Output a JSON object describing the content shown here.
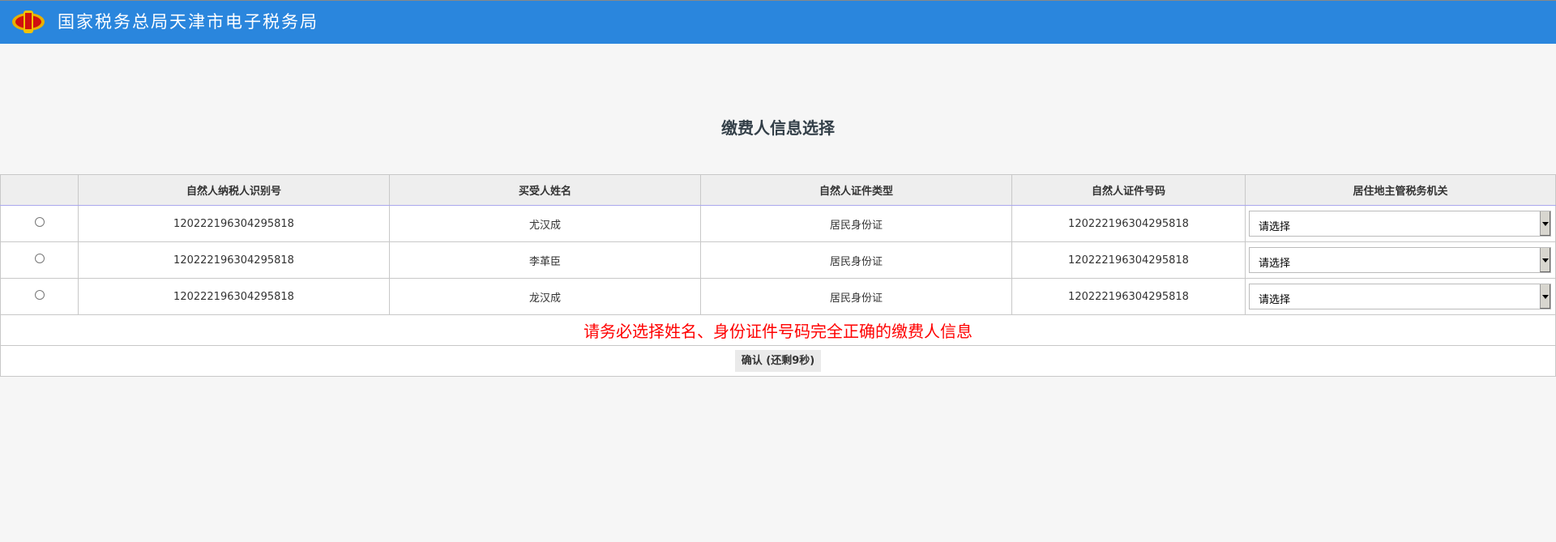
{
  "header": {
    "title": "国家税务总局天津市电子税务局",
    "logo_icon": "tax-emblem-icon"
  },
  "page": {
    "title": "缴费人信息选择"
  },
  "table": {
    "columns": [
      "",
      "自然人纳税人识别号",
      "买受人姓名",
      "自然人证件类型",
      "自然人证件号码",
      "居住地主管税务机关"
    ],
    "rows": [
      {
        "tin": "120222196304295818",
        "name": "尤汉成",
        "id_type": "居民身份证",
        "id_no": "120222196304295818",
        "authority": "请选择"
      },
      {
        "tin": "120222196304295818",
        "name": "李革臣",
        "id_type": "居民身份证",
        "id_no": "120222196304295818",
        "authority": "请选择"
      },
      {
        "tin": "120222196304295818",
        "name": "龙汉成",
        "id_type": "居民身份证",
        "id_no": "120222196304295818",
        "authority": "请选择"
      }
    ]
  },
  "warning": "请务必选择姓名、身份证件号码完全正确的缴费人信息",
  "confirm_label": "确认 (还剩9秒)",
  "colors": {
    "header_bg": "#2a86dd",
    "warning": "#ff0000"
  }
}
